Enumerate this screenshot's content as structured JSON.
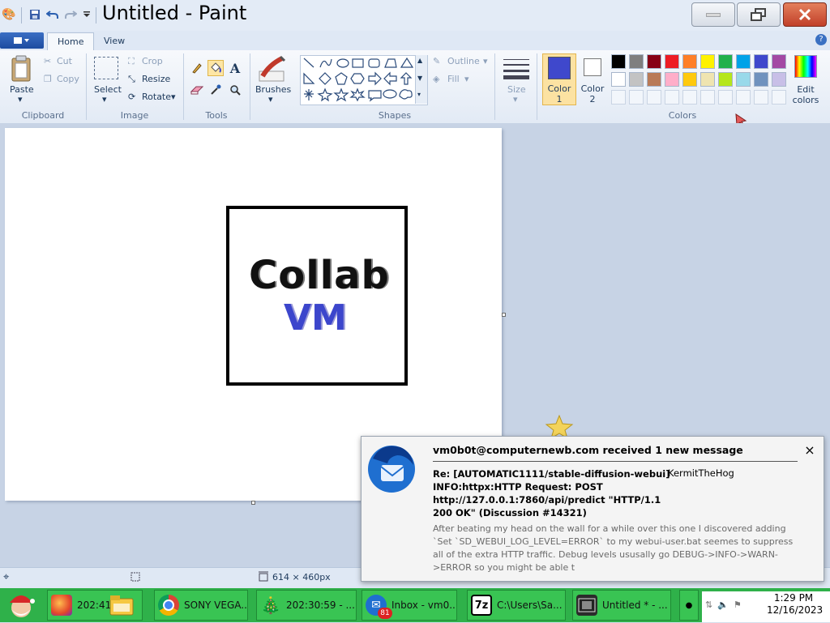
{
  "window": {
    "title": "Untitled - Paint",
    "minimize_icon": "minimize-icon",
    "maximize_icon": "restore-icon",
    "close_icon": "close-icon"
  },
  "ribbon": {
    "tabs": [
      {
        "label": "Home",
        "active": true
      },
      {
        "label": "View",
        "active": false
      }
    ],
    "clipboard": {
      "group": "Clipboard",
      "paste": "Paste",
      "cut": "Cut",
      "copy": "Copy"
    },
    "image": {
      "group": "Image",
      "select": "Select",
      "crop": "Crop",
      "resize": "Resize",
      "rotate": "Rotate"
    },
    "tools": {
      "group": "Tools"
    },
    "brushes": "Brushes",
    "shapes": {
      "group": "Shapes",
      "outline": "Outline",
      "fill": "Fill"
    },
    "size": "Size",
    "colors": {
      "group": "Colors",
      "color1_label": "Color",
      "color1_num": "1",
      "color2_label": "Color",
      "color2_num": "2",
      "edit": "Edit",
      "edit2": "colors",
      "color1": "#3f48cc",
      "color2": "#ffffff",
      "palette_row1": [
        "#000000",
        "#7f7f7f",
        "#880015",
        "#ed1c24",
        "#ff7f27",
        "#fff200",
        "#22b14c",
        "#00a2e8",
        "#3f48cc",
        "#a349a4"
      ],
      "palette_row2": [
        "#ffffff",
        "#c3c3c3",
        "#b97a57",
        "#ffaec9",
        "#ffc90e",
        "#efe4b0",
        "#b5e61d",
        "#99d9ea",
        "#7092be",
        "#c8bfe7"
      ]
    }
  },
  "canvas": {
    "art_line1": "Collab",
    "art_line2": "VM"
  },
  "statusbar": {
    "dimensions": "614 × 460px"
  },
  "notification": {
    "title": "vm0b0t@computernewb.com received 1 new message",
    "subject": "Re: [AUTOMATIC1111/stable-diffusion-webui] INFO:httpx:HTTP Request: POST http://127.0.0.1:7860/api/predict \"HTTP/1.1 200 OK\" (Discussion #14321)",
    "sender": "KermitTheHog",
    "body": "After beating my head on the wall for a while over this one I discovered adding `Set `SD_WEBUI_LOG_LEVEL=ERROR` to my webui-user.bat seemes to suppress all of the extra HTTP traffic. Debug levels ususally go DEBUG->INFO->WARN->ERROR so you might be able t",
    "close": "×"
  },
  "taskbar": {
    "items": [
      {
        "label": "202:41"
      },
      {
        "label": "SONY VEGA..."
      },
      {
        "label": "202:30:59 - ..."
      },
      {
        "label": "Inbox - vm0..."
      },
      {
        "label": "C:\\Users\\Sa..."
      },
      {
        "label": "Untitled * - ..."
      }
    ],
    "inbox_badge": "81",
    "clock_time": "1:29 PM",
    "clock_date": "12/16/2023"
  }
}
